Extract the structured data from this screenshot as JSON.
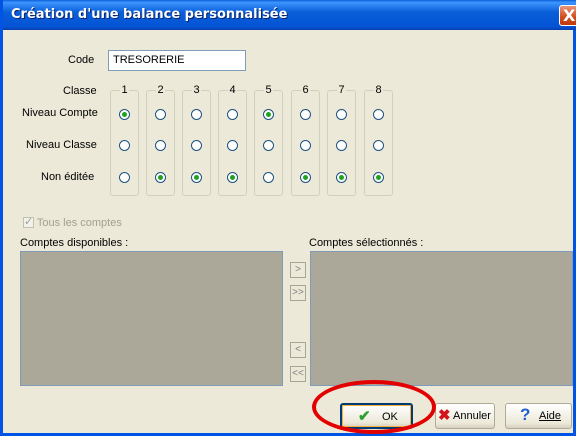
{
  "window": {
    "title": "Création d'une balance personnalisée",
    "close_glyph": "X"
  },
  "form": {
    "code_label": "Code",
    "code_value": "TRESORERIE",
    "classe_label": "Classe",
    "row_labels": [
      "Niveau Compte",
      "Niveau Classe",
      "Non éditée"
    ]
  },
  "classes": [
    {
      "number": "1",
      "selected_row": 0
    },
    {
      "number": "2",
      "selected_row": 2
    },
    {
      "number": "3",
      "selected_row": 2
    },
    {
      "number": "4",
      "selected_row": 2
    },
    {
      "number": "5",
      "selected_row": 0
    },
    {
      "number": "6",
      "selected_row": 2
    },
    {
      "number": "7",
      "selected_row": 2
    },
    {
      "number": "8",
      "selected_row": 2
    }
  ],
  "all_accounts": {
    "label": "Tous les comptes",
    "checked": true,
    "disabled": true
  },
  "lists": {
    "available_label": "Comptes disponibles :",
    "selected_label": "Comptes sélectionnés :"
  },
  "arrows": {
    "add_one": ">",
    "add_all": ">>",
    "remove_one": "<",
    "remove_all": "<<"
  },
  "buttons": {
    "ok": "OK",
    "cancel": "Annuler",
    "help": "Aide"
  },
  "icons": {
    "ok": "check-icon",
    "cancel": "x-icon",
    "help": "question-icon"
  },
  "colors": {
    "titlebar": "#0a5fd8",
    "highlight": "#e30000",
    "radio_dot": "#21a121"
  }
}
